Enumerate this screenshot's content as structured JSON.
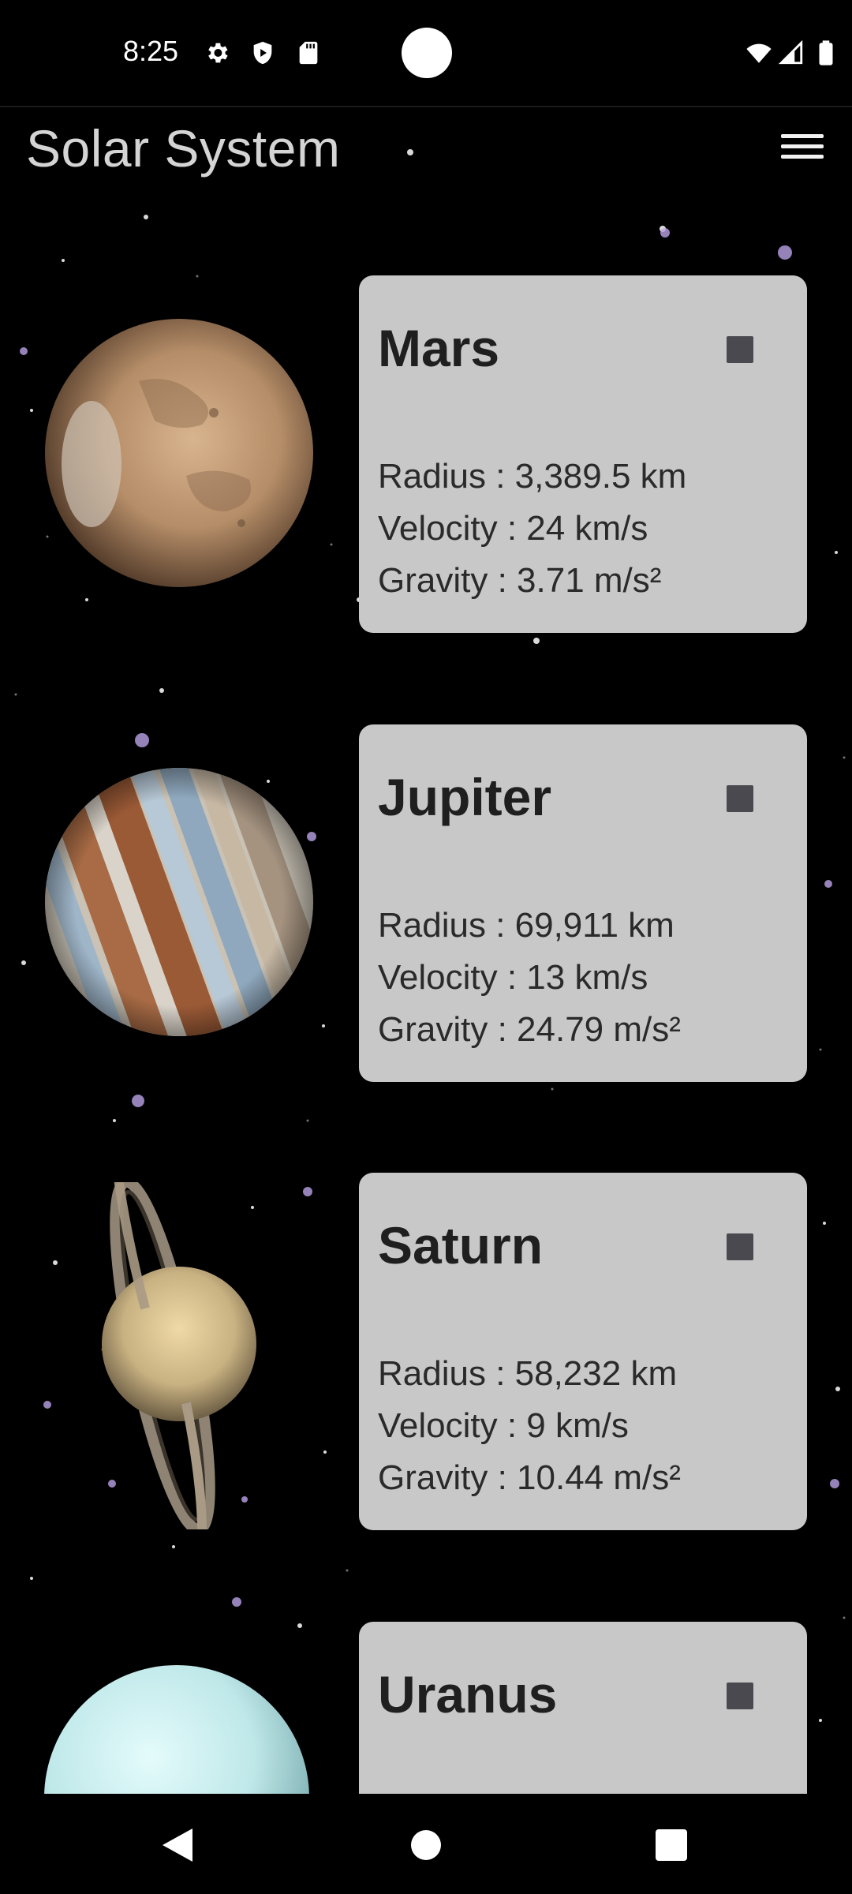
{
  "status_bar": {
    "time": "8:25",
    "left_icons": [
      "gear-icon",
      "shield-play-icon",
      "sd-card-icon"
    ],
    "right_icons": [
      "wifi-icon",
      "signal-icon",
      "battery-icon"
    ]
  },
  "app_bar": {
    "title": "Solar System",
    "menu_icon": "hamburger-menu-icon"
  },
  "planets": [
    {
      "name": "Mars",
      "radius": "Radius : 3,389.5 km",
      "velocity": "Velocity : 24 km/s",
      "gravity": "Gravity : 3.71 m/s²",
      "image": "mars-planet-image"
    },
    {
      "name": "Jupiter",
      "radius": "Radius : 69,911 km",
      "velocity": "Velocity : 13 km/s",
      "gravity": "Gravity : 24.79 m/s²",
      "image": "jupiter-planet-image"
    },
    {
      "name": "Saturn",
      "radius": "Radius : 58,232 km",
      "velocity": "Velocity : 9 km/s",
      "gravity": "Gravity : 10.44 m/s²",
      "image": "saturn-planet-image"
    },
    {
      "name": "Uranus",
      "image": "uranus-planet-image"
    }
  ],
  "nav_bar": {
    "icons": [
      "back-triangle-icon",
      "home-circle-icon",
      "recents-square-icon"
    ]
  },
  "colors": {
    "background": "#000000",
    "card": "#c8c8c8",
    "card_text": "#1f1f1f",
    "title_text": "#d4d4d4",
    "stop_icon": "#4a4950"
  }
}
